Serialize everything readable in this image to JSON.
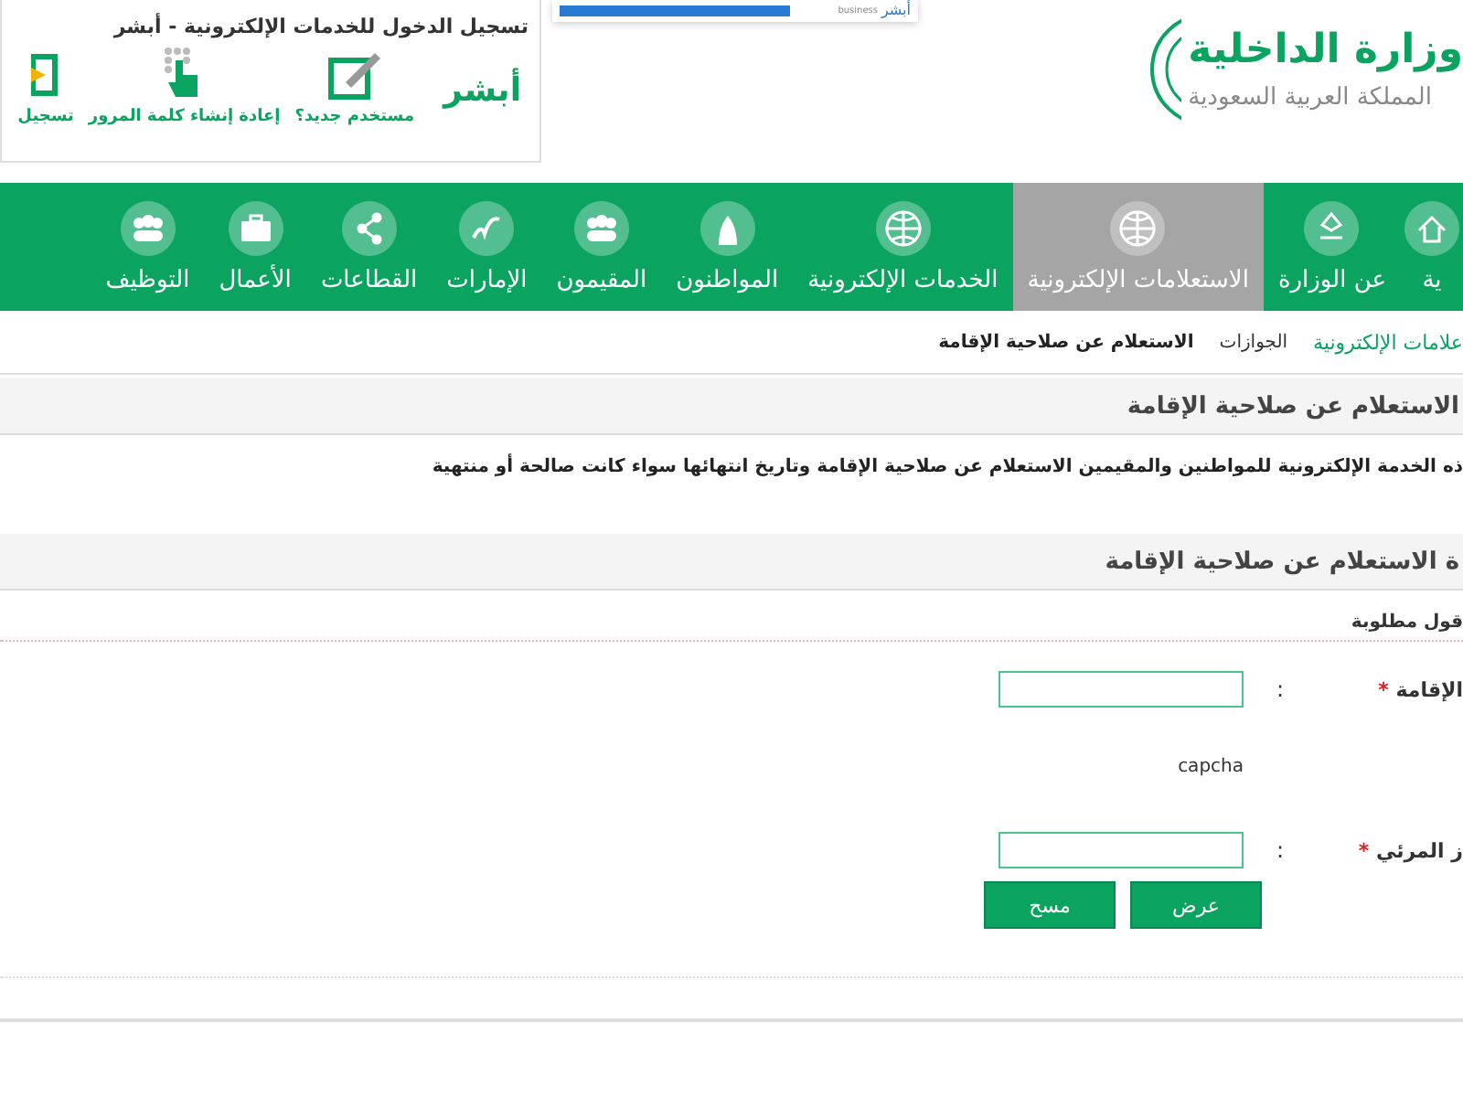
{
  "header": {
    "logo_title": "وزارة الداخلية",
    "logo_subtitle": "المملكة العربية السعودية",
    "promo": {
      "brand": "أبشر",
      "tag": "business"
    },
    "absher": {
      "title": "تسجيل الدخول للخدمات الإلكترونية - أبشر",
      "logo_text": "أبشر",
      "items": [
        {
          "label": "مستخدم جديد؟"
        },
        {
          "label": "إعادة إنشاء كلمة المرور"
        },
        {
          "label": "تسجيل"
        }
      ]
    }
  },
  "nav": [
    {
      "label": "ية",
      "selected": false
    },
    {
      "label": "عن الوزارة",
      "selected": false
    },
    {
      "label": "الاستعلامات الإلكترونية",
      "selected": true
    },
    {
      "label": "الخدمات الإلكترونية",
      "selected": false
    },
    {
      "label": "المواطنون",
      "selected": false
    },
    {
      "label": "المقيمون",
      "selected": false
    },
    {
      "label": "الإمارات",
      "selected": false
    },
    {
      "label": "القطاعات",
      "selected": false
    },
    {
      "label": "الأعمال",
      "selected": false
    },
    {
      "label": "التوظيف",
      "selected": false
    }
  ],
  "breadcrumb": [
    {
      "label": "علامات الإلكترونية",
      "kind": "link"
    },
    {
      "label": "الجوازات",
      "kind": "link-plain"
    },
    {
      "label": "الاستعلام عن صلاحية الإقامة",
      "kind": "current"
    }
  ],
  "page_title": "الاستعلام عن صلاحية الإقامة",
  "description": "ذه الخدمة الإلكترونية للمواطنين والمقيمين الاستعلام عن صلاحية الإقامة وتاريخ انتهائها سواء كانت صالحة أو منتهية",
  "form": {
    "title": "ة الاستعلام عن صلاحية الإقامة",
    "required_note": "قول مطلوبة",
    "rows": [
      {
        "kind": "input",
        "label": "الإقامة",
        "required": true,
        "required_mark": "*",
        "separator": ":"
      },
      {
        "kind": "captcha",
        "text": "capcha"
      },
      {
        "kind": "input",
        "label": "ز المرئي",
        "required": true,
        "required_mark": "*",
        "separator": ":"
      }
    ],
    "buttons": [
      {
        "label": "عرض"
      },
      {
        "label": "مسح"
      }
    ]
  }
}
